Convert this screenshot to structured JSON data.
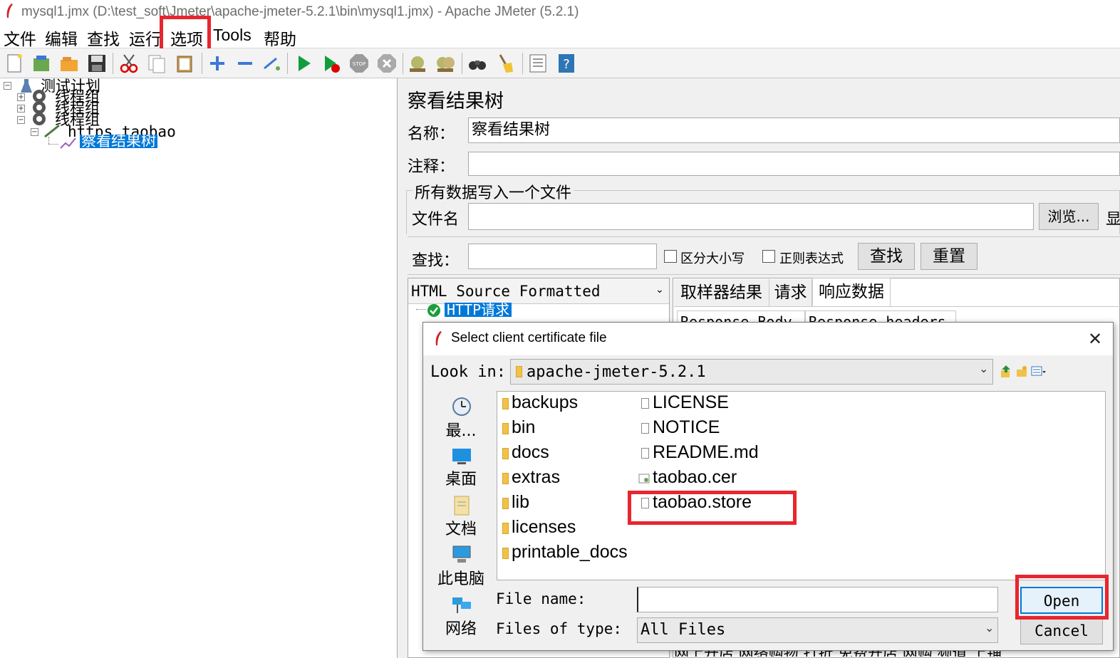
{
  "window": {
    "title": "mysql1.jmx (D:\\test_soft\\Jmeter\\apache-jmeter-5.2.1\\bin\\mysql1.jmx) - Apache JMeter (5.2.1)"
  },
  "menubar": [
    "文件",
    "编辑",
    "查找",
    "运行",
    "选项",
    "Tools",
    "帮助"
  ],
  "tree": {
    "root": "测试计划",
    "thread_groups": [
      "线程组",
      "线程组",
      "线程组"
    ],
    "sampler": "https_taobao",
    "listener": "察看结果树"
  },
  "panel": {
    "title": "察看结果树",
    "name_label": "名称：",
    "name_value": "察看结果树",
    "comment_label": "注释：",
    "comment_value": "",
    "file_section": "所有数据写入一个文件",
    "filename_label": "文件名",
    "filename_value": "",
    "browse_button": "浏览...",
    "display_trunc": "显",
    "search_label": "查找：",
    "search_value": "",
    "case_sensitive": "区分大小写",
    "regex": "正则表达式",
    "find_button": "查找",
    "reset_button": "重置",
    "renderer": "HTML Source Formatted",
    "result_item": "HTTP请求",
    "tabs": [
      "取样器结果",
      "请求",
      "响应数据"
    ],
    "subtabs": [
      "Response Body",
      "Response headers"
    ],
    "bottom_text": "网上开店 网络购物 打折 免费开店 网购 频道 上铺"
  },
  "dialog": {
    "title": "Select client certificate file",
    "look_in_label": "Look in:",
    "look_in_value": "apache-jmeter-5.2.1",
    "places": [
      "最...",
      "桌面",
      "文档",
      "此电脑",
      "网络"
    ],
    "folders": [
      "backups",
      "bin",
      "docs",
      "extras",
      "lib",
      "licenses",
      "printable_docs"
    ],
    "files": [
      "LICENSE",
      "NOTICE",
      "README.md",
      "taobao.cer",
      "taobao.store"
    ],
    "file_name_label": "File name:",
    "file_name_value": "",
    "files_of_type_label": "Files of type:",
    "files_of_type_value": "All Files",
    "open_button": "Open",
    "cancel_button": "Cancel",
    "close_glyph": "✕"
  },
  "colors": {
    "highlight": "#e8262f",
    "selection": "#0078d7",
    "folder": "#f0c24a"
  }
}
